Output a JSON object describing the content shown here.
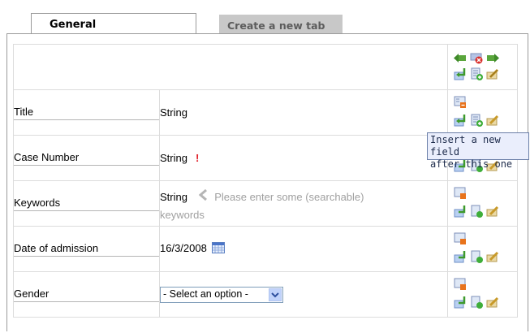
{
  "tabs": [
    {
      "label": "General"
    },
    {
      "label": "Create a new tab"
    }
  ],
  "fields": [
    {
      "label": "Title",
      "type": "String",
      "required": false,
      "hint": "",
      "hint2": ""
    },
    {
      "label": "Case Number",
      "type": "String",
      "required": true,
      "required_mark": "!",
      "hint": "",
      "hint2": ""
    },
    {
      "label": "Keywords",
      "type": "String",
      "required": false,
      "hint": "Please enter some (searchable)",
      "hint2": "keywords"
    },
    {
      "label": "Date of admission",
      "value": "16/3/2008"
    },
    {
      "label": "Gender",
      "select": "- Select an option -"
    }
  ],
  "tooltip": {
    "line1": "Insert a new field",
    "line2": "after this one"
  },
  "icons": {
    "top": [
      "move-left-icon",
      "delete-icon",
      "move-right-icon"
    ],
    "row": [
      "field-properties-icon",
      "insert-field-icon",
      "add-field-icon",
      "edit-icon"
    ]
  },
  "colors": {
    "tab_inactive_bg": "#c8c8c8",
    "tooltip_bg": "#eaeefc",
    "required": "#e0202a"
  }
}
